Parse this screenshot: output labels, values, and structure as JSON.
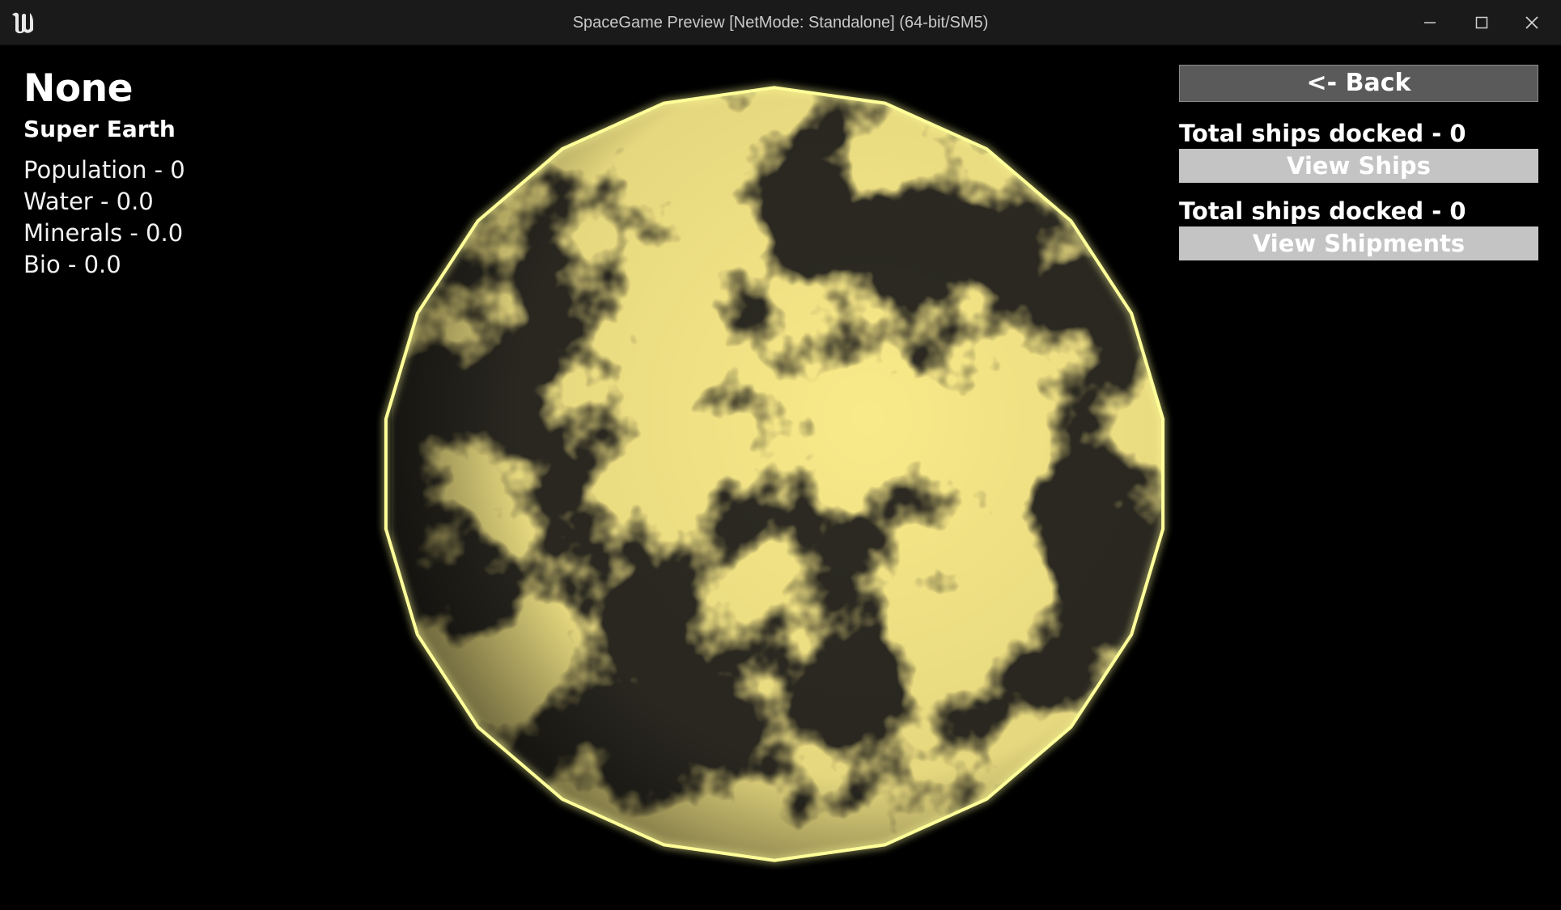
{
  "window": {
    "title": "SpaceGame Preview [NetMode: Standalone]  (64-bit/SM5)",
    "logo_icon": "unreal-engine-logo-icon",
    "controls": {
      "minimize_icon": "minimize-icon",
      "maximize_icon": "maximize-icon",
      "close_icon": "close-icon"
    }
  },
  "planet": {
    "name": "None",
    "type": "Super Earth",
    "stats": [
      "Population - 0",
      "Water - 0.0",
      "Minerals - 0.0",
      "Bio - 0.0"
    ],
    "colors": {
      "surface_dark": "#2c2a22",
      "surface_light": "#f2d649",
      "outline": "#ffff9a"
    }
  },
  "panel": {
    "back_label": "<- Back",
    "ships_docked_label": "Total ships docked - 0",
    "view_ships_label": "View Ships",
    "shipments_docked_label": "Total ships docked - 0",
    "view_shipments_label": "View Shipments"
  }
}
